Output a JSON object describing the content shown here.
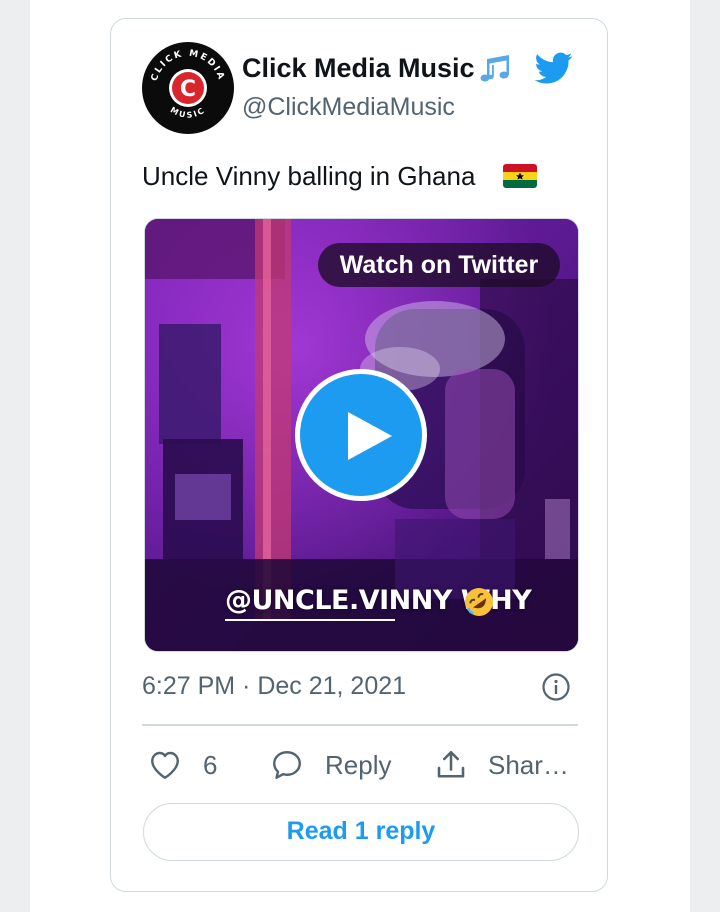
{
  "tweet": {
    "author": {
      "display_name": "Click Media Music",
      "handle": "@ClickMediaMusic",
      "avatar_text_top": "CLICK MEDIA",
      "avatar_text_bottom": "MUSIC",
      "avatar_letter": "C"
    },
    "text": "Uncle Vinny balling in Ghana",
    "media": {
      "watch_label": "Watch on Twitter",
      "caption": "@UNCLE.VINNY WHY"
    },
    "timestamp": "6:27 PM · Dec 21, 2021",
    "actions": {
      "like_count": "6",
      "reply_label": "Reply",
      "share_label": "Shar…"
    },
    "read_reply_label": "Read 1 reply"
  },
  "icons": {
    "music": "musical-notes-icon",
    "bird": "twitter-bird-icon",
    "flag": "ghana-flag-icon",
    "play": "play-icon",
    "emoji": "rolling-on-floor-laughing-icon",
    "info": "info-icon",
    "like": "heart-icon",
    "reply": "reply-bubble-icon",
    "share": "share-icon"
  },
  "colors": {
    "accent": "#1d9bf0",
    "text": "#0f1419",
    "secondary": "#536471",
    "border": "#cfd9de",
    "avatar_red": "#d8262c",
    "media_purple": "#6a1fa0"
  }
}
